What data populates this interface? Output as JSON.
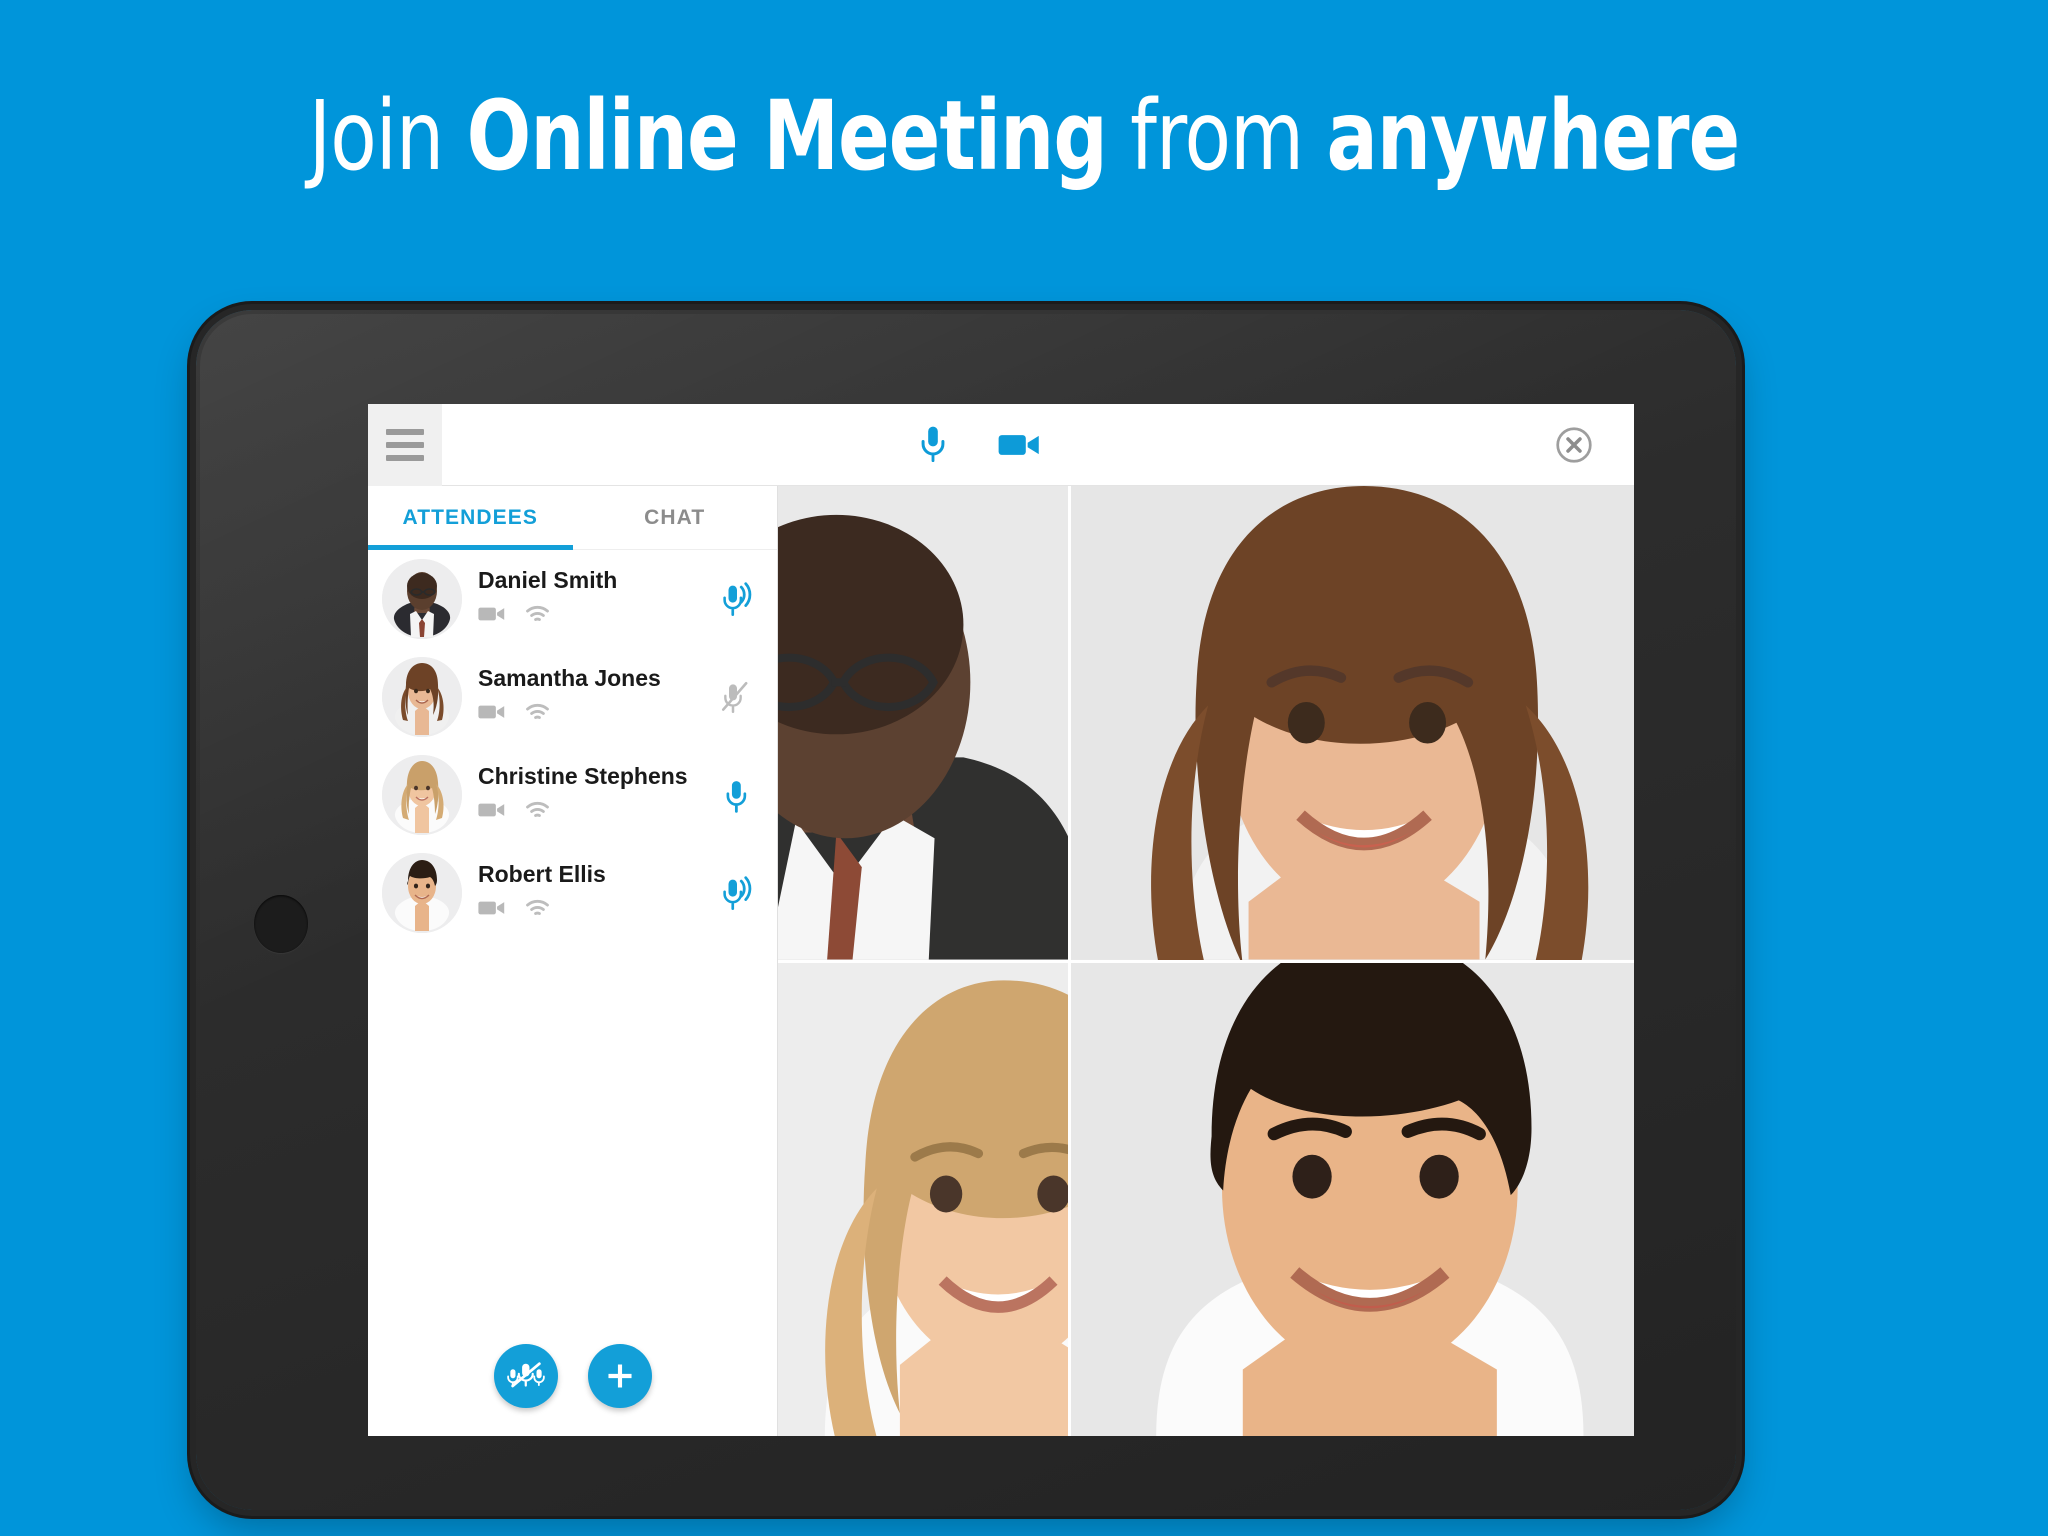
{
  "page": {
    "background_color": "#0095da",
    "accent_color": "#139fd8"
  },
  "headline": {
    "part1": "Join ",
    "part2": "Online Meeting",
    "part3": " from ",
    "part4": "anywhere",
    "full_text": "Join Online Meeting from anywhere"
  },
  "app_header": {
    "menu_icon": "hamburger-menu-icon",
    "mic_icon": "microphone-icon",
    "video_icon": "video-camera-icon",
    "close_icon": "close-circle-icon"
  },
  "sidebar": {
    "tabs": [
      {
        "label": "ATTENDEES",
        "active": true
      },
      {
        "label": "CHAT",
        "active": false
      }
    ],
    "attendees": [
      {
        "name": "Daniel Smith",
        "video_icon": "video-camera-icon",
        "wifi_icon": "wifi-icon",
        "mic_state": "speaking",
        "mic_icon": "microphone-active-icon",
        "mic_color": "#139fd8"
      },
      {
        "name": "Samantha Jones",
        "video_icon": "video-camera-icon",
        "wifi_icon": "wifi-icon",
        "mic_state": "muted",
        "mic_icon": "microphone-muted-icon",
        "mic_color": "#b5b5b5"
      },
      {
        "name": "Christine Stephens",
        "video_icon": "video-camera-icon",
        "wifi_icon": "wifi-icon",
        "mic_state": "on",
        "mic_icon": "microphone-icon",
        "mic_color": "#139fd8"
      },
      {
        "name": "Robert Ellis",
        "video_icon": "video-camera-icon",
        "wifi_icon": "wifi-icon",
        "mic_state": "speaking",
        "mic_icon": "microphone-active-icon",
        "mic_color": "#139fd8"
      }
    ],
    "actions": [
      {
        "name": "mute-all",
        "icon": "microphone-mute-all-icon"
      },
      {
        "name": "add-participant",
        "icon": "plus-icon"
      }
    ]
  },
  "video_grid": {
    "tiles": [
      {
        "position": "top-left",
        "participant": "Daniel Smith"
      },
      {
        "position": "top-right",
        "participant": "Samantha Jones"
      },
      {
        "position": "bottom-left",
        "participant": "Christine Stephens"
      },
      {
        "position": "bottom-right",
        "participant": "Robert Ellis"
      }
    ]
  },
  "device": {
    "type": "tablet",
    "home_button": "home-button"
  }
}
